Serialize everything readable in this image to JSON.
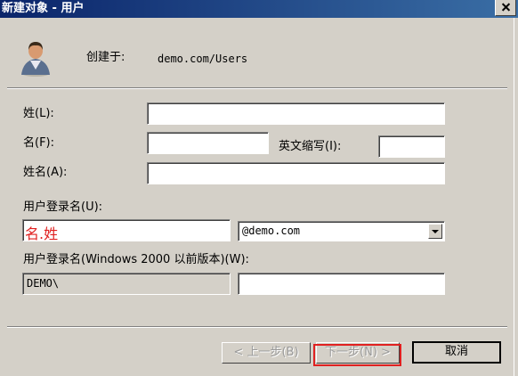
{
  "window": {
    "title": "新建对象 - 用户"
  },
  "header": {
    "created_in_label": "创建于:",
    "created_in_value": "demo.com/Users",
    "icon": "user-icon"
  },
  "form": {
    "last_name_label": "姓(L):",
    "last_name_value": "",
    "first_name_label": "名(F):",
    "first_name_value": "",
    "initials_label": "英文缩写(I):",
    "initials_value": "",
    "full_name_label": "姓名(A):",
    "full_name_value": "",
    "logon_name_label": "用户登录名(U):",
    "logon_name_value": "名.姓",
    "domain_selected": "@demo.com",
    "pre2000_label": "用户登录名(Windows 2000 以前版本)(W):",
    "pre2000_domain": "DEMO\\",
    "pre2000_value": ""
  },
  "buttons": {
    "back": "< 上一步(B)",
    "next": "下一步(N) >",
    "cancel": "取消"
  },
  "colors": {
    "titlebar": "#0a246a",
    "dialog": "#d4d0c8",
    "annotation": "#e02020"
  }
}
